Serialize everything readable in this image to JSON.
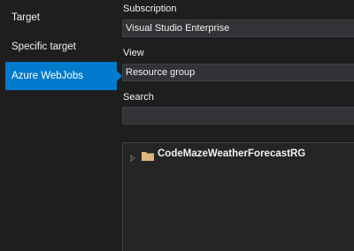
{
  "nav": {
    "items": [
      {
        "label": "Target"
      },
      {
        "label": "Specific target"
      },
      {
        "label": "Azure WebJobs"
      }
    ]
  },
  "form": {
    "subscription_label": "Subscription",
    "subscription_value": "Visual Studio Enterprise",
    "view_label": "View",
    "view_value": "Resource group",
    "search_label": "Search",
    "search_value": ""
  },
  "tree": {
    "node_label": "CodeMazeWeatherForecastRG"
  },
  "colors": {
    "background": "#1e1e1e",
    "selected": "#007acc",
    "field": "#333337",
    "folder": "#dcb67a"
  }
}
